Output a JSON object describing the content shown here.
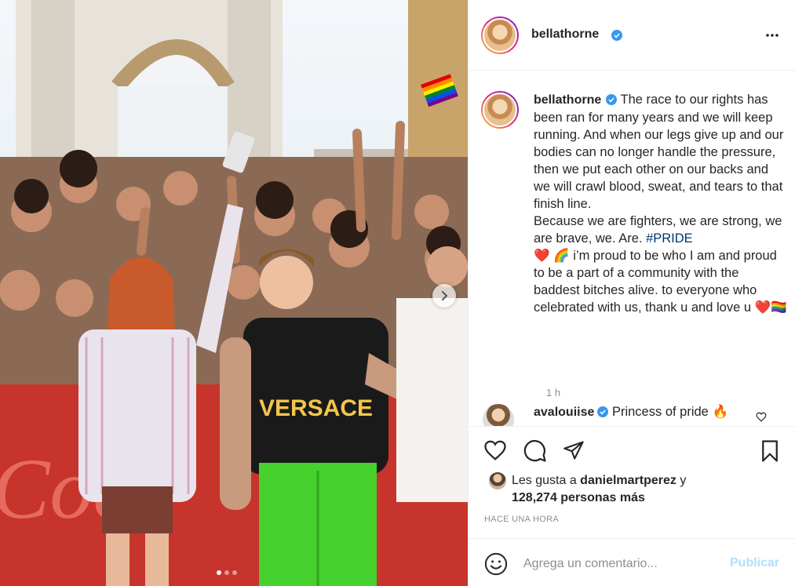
{
  "post": {
    "username": "bellathorne",
    "verified": true,
    "image_alt_icon": "crowd-photo-image",
    "carousel": {
      "slides": 3,
      "active": 0
    }
  },
  "caption": {
    "username": "bellathorne",
    "text_part1": "The race to our rights has been ran for many years and we will keep running. And when our legs give up and our bodies can no longer handle the pressure, then we put each other on our backs and we will crawl blood, sweat, and tears to that finish line.\nBecause we are fighters, we are strong, we are brave, we. Are. ",
    "hashtag": "#PRIDE",
    "emoji1": "❤️",
    "emoji2": "🌈",
    "text_part2": " i’m proud to be who I am and proud to be a part of a community with the baddest bitches alive. to everyone who celebrated with us, thank u and love u ",
    "emoji3": "❤️",
    "emoji4": "🏳️‍🌈",
    "time": "1 h"
  },
  "comment": {
    "username": "avalouiise",
    "verified": true,
    "text": "Princess of pride",
    "emoji": "🔥"
  },
  "likes": {
    "prefix": "Les gusta a ",
    "user": "danielmartperez",
    "suffix": " y",
    "count_line": "128,274 personas más"
  },
  "date_label": "HACE UNA HORA",
  "add_comment": {
    "placeholder": "Agrega un comentario...",
    "publish_label": "Publicar"
  },
  "colors": {
    "verified": "#3897f0",
    "hashtag": "#00376b",
    "publish_disabled": "#b2dffc",
    "muted": "#8e8e8e"
  }
}
